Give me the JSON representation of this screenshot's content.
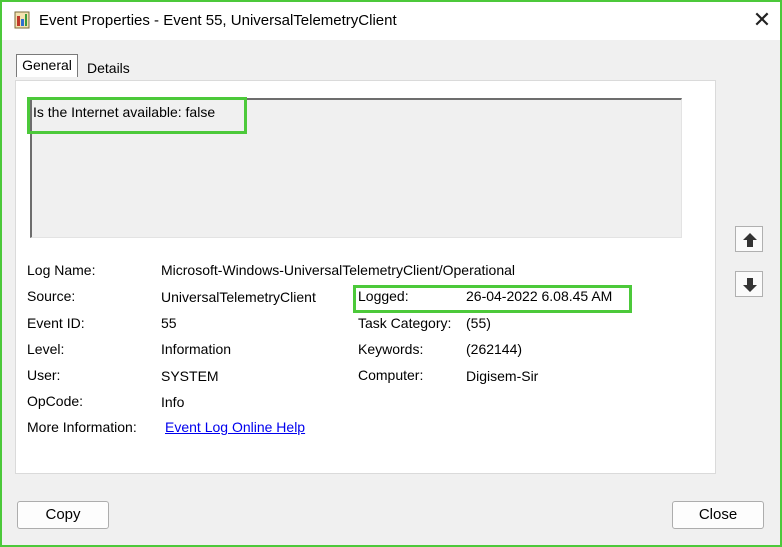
{
  "window": {
    "title": "Event Properties - Event 55, UniversalTelemetryClient",
    "close_glyph": "✕"
  },
  "tabs": [
    {
      "label": "General",
      "active": true
    },
    {
      "label": "Details",
      "active": false
    }
  ],
  "description": "Is the Internet available: false",
  "fields": {
    "log_name": {
      "label": "Log Name:",
      "value": "Microsoft-Windows-UniversalTelemetryClient/Operational"
    },
    "source": {
      "label": "Source:",
      "value": "UniversalTelemetryClient"
    },
    "logged": {
      "label": "Logged:",
      "value": "26-04-2022 6.08.45 AM"
    },
    "event_id": {
      "label": "Event ID:",
      "value": "55"
    },
    "task_category": {
      "label": "Task Category:",
      "value": "(55)"
    },
    "level": {
      "label": "Level:",
      "value": "Information"
    },
    "keywords": {
      "label": "Keywords:",
      "value": "(262144)"
    },
    "user": {
      "label": "User:",
      "value": "SYSTEM"
    },
    "computer": {
      "label": "Computer:",
      "value": "Digisem-Sir"
    },
    "opcode": {
      "label": "OpCode:",
      "value": "Info"
    },
    "more_information": {
      "label": "More Information:",
      "value": "Event Log Online Help"
    }
  },
  "buttons": {
    "copy": "Copy",
    "close": "Close"
  },
  "icons": {
    "app": "event-viewer-icon",
    "up": "arrow-up-icon",
    "down": "arrow-down-icon"
  },
  "colors": {
    "highlight": "#4cc93a",
    "link": "#0000ee"
  }
}
